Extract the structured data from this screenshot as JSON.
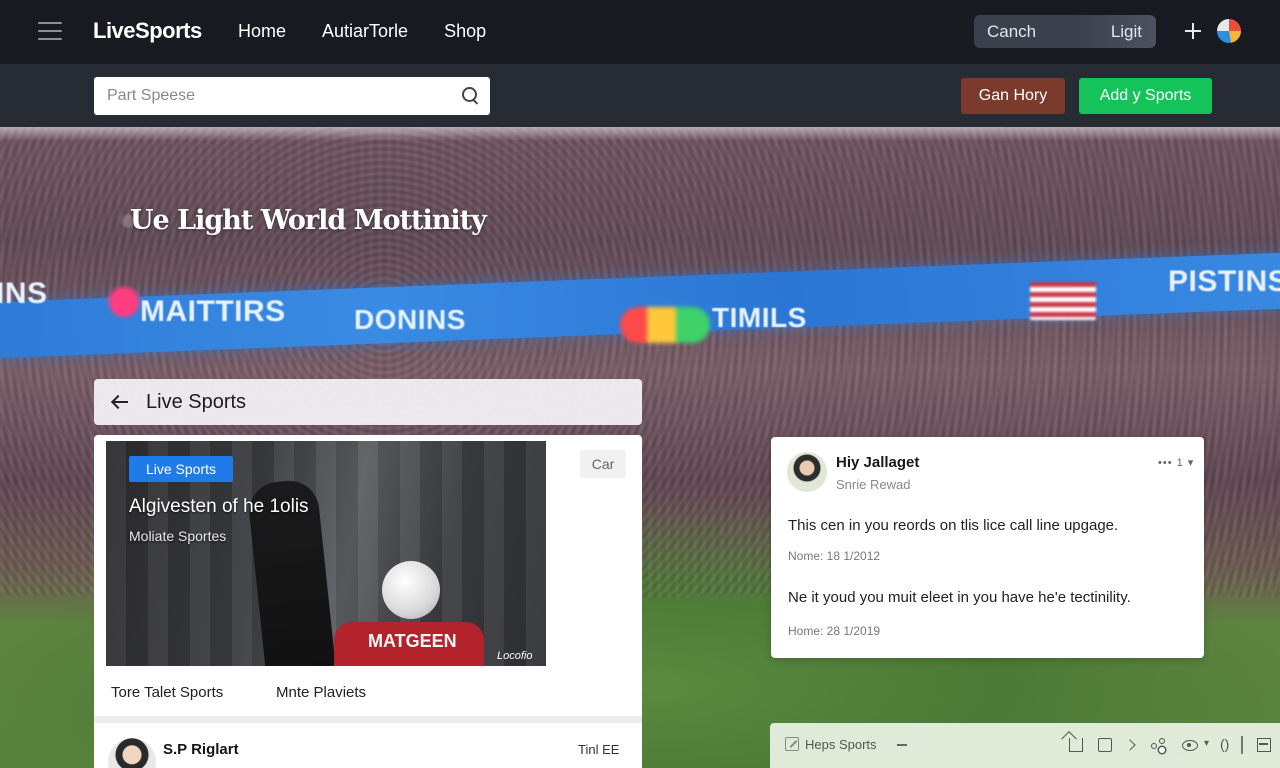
{
  "nav": {
    "brand": "LiveSports",
    "links": [
      "Home",
      "AutiarTorle",
      "Shop"
    ],
    "toggle": {
      "left": "Canch",
      "right": "Ligit"
    }
  },
  "subbar": {
    "search_placeholder": "Part Speese",
    "btn_primary": "Gan Hory",
    "btn_add": "Add y Sports"
  },
  "hero": {
    "title": "Ue Light World Mottinity",
    "banner": [
      "INS",
      "MAITTIRS",
      "DONINS",
      "TIMILS",
      "PISTINS"
    ]
  },
  "panel": {
    "title": "Live Sports",
    "video": {
      "badge": "Live Sports",
      "title": "Algivesten of he 1olis",
      "subtitle": "Moliate Sportes",
      "jersey": "MATGEEN",
      "tag": "Locofio"
    },
    "chip": "Car",
    "tabs": [
      "Tore Talet Sports",
      "Mnte Plaviets"
    ],
    "row": {
      "name": "S.P Riglart",
      "meta": "Tinl EE"
    }
  },
  "card": {
    "name": "Hiy Jallaget",
    "sub": "Snrie Rewad",
    "more": "••• 1 ▾",
    "comments": [
      {
        "text": "This cen in you reords on tlis lice call line upgage.",
        "date": "Nome: 18 1/2012"
      },
      {
        "text": "Ne it youd you muit eleet in you have he'e tectinility.",
        "date": "Home: 28 1/2019"
      }
    ]
  },
  "toolbar": {
    "label": "Heps Sports",
    "caret": "▾",
    "paren": "()"
  },
  "colors": {
    "nav_bg": "#171a21",
    "subbar_bg": "#262b34",
    "accent_green": "#14c45a",
    "accent_brown": "#7a3a2c",
    "badge_blue": "#1f7be8"
  },
  "icons": [
    "menu-icon",
    "plus-icon",
    "globe-icon",
    "search-icon",
    "back-arrow-icon",
    "edit-icon",
    "home-icon",
    "box-icon",
    "chevron-right-icon",
    "share-icon",
    "eye-icon",
    "grid-icon"
  ]
}
